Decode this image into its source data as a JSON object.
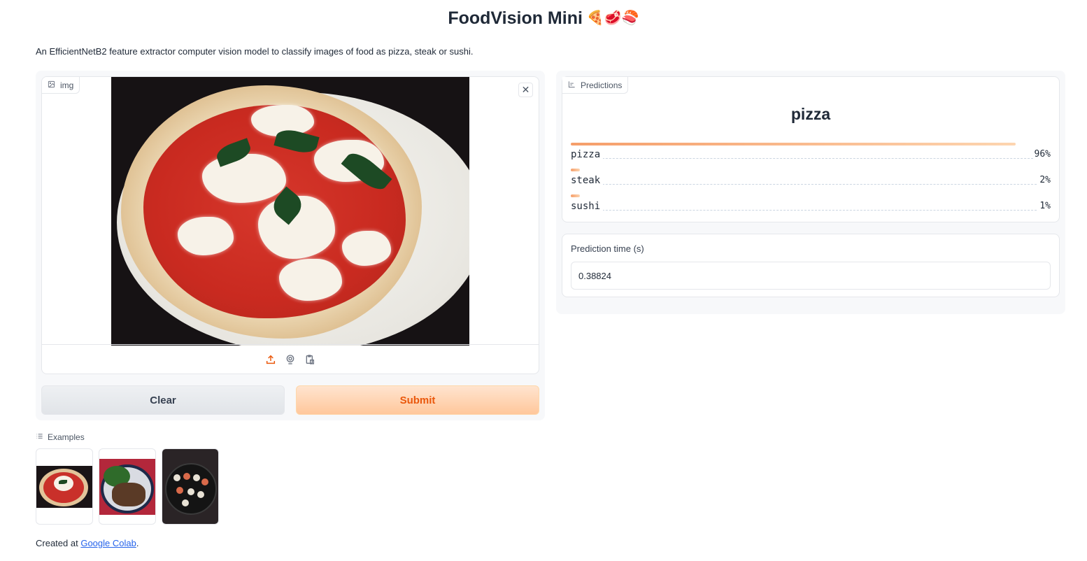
{
  "app": {
    "title": "FoodVision Mini",
    "title_emoji": "🍕🥩🍣",
    "description": "An EfficientNetB2 feature extractor computer vision model to classify images of food as pizza, steak or sushi."
  },
  "input": {
    "label": "img",
    "icon": "image-icon",
    "clear_icon": "close-icon",
    "tools": [
      "upload-icon",
      "webcam-icon",
      "clipboard-icon"
    ]
  },
  "buttons": {
    "clear": "Clear",
    "submit": "Submit"
  },
  "predictions": {
    "label": "Predictions",
    "top_class": "pizza",
    "items": [
      {
        "label": "pizza",
        "percent_text": "96%",
        "fraction": 0.96
      },
      {
        "label": "steak",
        "percent_text": "2%",
        "fraction": 0.02
      },
      {
        "label": "sushi",
        "percent_text": "1%",
        "fraction": 0.01
      }
    ]
  },
  "prediction_time": {
    "label": "Prediction time (s)",
    "value": "0.38824"
  },
  "examples": {
    "label": "Examples",
    "items": [
      "pizza-example",
      "steak-example",
      "sushi-example"
    ]
  },
  "footer": {
    "prefix": "Created at ",
    "link_text": "Google Colab",
    "suffix": "."
  },
  "colors": {
    "accent": "#ea580c",
    "bar_start": "#f59e6a",
    "bar_end": "#fdd5b0"
  }
}
